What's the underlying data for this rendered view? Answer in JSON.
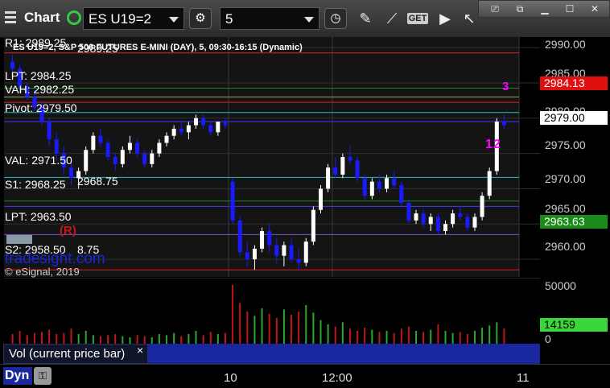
{
  "toolbar": {
    "title": "Chart",
    "symbol": "ES U19=2",
    "interval": "5",
    "get_label": "GET"
  },
  "chart_header": {
    "title": "ES U19=2, S&P 500 FUTURES E-MINI (DAY), 5, 09:30-16:15 (Dynamic)",
    "copyright": "© eSignal, 2019",
    "watermark": "tradesight.com"
  },
  "price_axis": {
    "ticks": [
      "2990.00",
      "2985.00",
      "2980.00",
      "2975.00",
      "2970.00",
      "2965.00",
      "2960.00"
    ],
    "tag_high": "2984.13",
    "tag_last": "2979.00",
    "tag_low": "2963.63"
  },
  "volume_axis": {
    "ticks": [
      "50000",
      "0"
    ],
    "tag_volume": "14159"
  },
  "levels": {
    "r1": "R1: 2989.25",
    "r1_extra": "2989.25",
    "lpt_upper": "LPT: 2984.25",
    "vah": "VAH: 2982.25",
    "pivot": "Pivot: 2979.50",
    "val": "VAL: 2971.50",
    "s1": "S1: 2968.25",
    "s1_extra": "2968.75",
    "lpt_lower": "LPT: 2963.50",
    "s2": "S2: 2958.50",
    "s2_extra": "8.75",
    "reversal": "(R)"
  },
  "markers": [
    "1",
    "2",
    "3"
  ],
  "legend": {
    "label": "Vol (current price bar)",
    "close": "×"
  },
  "x_axis": {
    "labels": [
      "10",
      "12:00",
      "11"
    ],
    "dyn_label": "Dyn"
  },
  "colors": {
    "up_candle": "#ffffff",
    "down_candle": "#1a1aff",
    "pivot_line": "#3a3aff",
    "r1_line": "#e02020",
    "val_line": "#20c0c0",
    "low_tag": "#1a8a1a",
    "high_tag": "#e01010",
    "volume_up": "#2aa82a",
    "volume_down": "#c01818"
  },
  "chart_data": {
    "type": "candlestick",
    "ylim": [
      2957.5,
      2991.5
    ],
    "ohlc": [
      [
        2988.0,
        2989.0,
        2986.5,
        2987.0
      ],
      [
        2987.0,
        2987.5,
        2984.0,
        2984.5
      ],
      [
        2984.5,
        2985.0,
        2982.5,
        2983.0
      ],
      [
        2983.0,
        2984.0,
        2981.0,
        2981.5
      ],
      [
        2981.5,
        2982.5,
        2979.0,
        2979.5
      ],
      [
        2979.5,
        2980.0,
        2976.0,
        2977.0
      ],
      [
        2977.0,
        2978.0,
        2974.0,
        2975.0
      ],
      [
        2975.0,
        2976.0,
        2972.0,
        2973.0
      ],
      [
        2973.0,
        2974.5,
        2970.5,
        2971.5
      ],
      [
        2971.5,
        2973.0,
        2970.0,
        2972.5
      ],
      [
        2972.5,
        2976.0,
        2972.0,
        2975.5
      ],
      [
        2975.5,
        2978.0,
        2975.0,
        2977.5
      ],
      [
        2977.5,
        2978.5,
        2976.0,
        2976.5
      ],
      [
        2976.5,
        2977.0,
        2974.0,
        2974.5
      ],
      [
        2974.5,
        2975.0,
        2972.5,
        2973.5
      ],
      [
        2973.5,
        2976.0,
        2973.0,
        2975.5
      ],
      [
        2975.5,
        2977.5,
        2975.0,
        2976.5
      ],
      [
        2976.5,
        2977.0,
        2974.5,
        2975.0
      ],
      [
        2975.0,
        2975.5,
        2973.0,
        2973.5
      ],
      [
        2973.5,
        2975.5,
        2973.0,
        2975.0
      ],
      [
        2975.0,
        2977.0,
        2974.5,
        2976.5
      ],
      [
        2976.5,
        2978.0,
        2976.0,
        2977.5
      ],
      [
        2977.5,
        2979.0,
        2977.0,
        2978.5
      ],
      [
        2978.5,
        2979.5,
        2977.5,
        2978.0
      ],
      [
        2978.0,
        2979.5,
        2977.0,
        2979.0
      ],
      [
        2979.0,
        2980.5,
        2978.5,
        2980.0
      ],
      [
        2980.0,
        2980.5,
        2978.5,
        2979.0
      ],
      [
        2979.0,
        2979.5,
        2977.5,
        2978.0
      ],
      [
        2978.0,
        2979.5,
        2977.5,
        2979.5
      ],
      [
        2979.5,
        2980.0,
        2978.5,
        2979.0
      ],
      [
        2971.0,
        2971.5,
        2965.0,
        2965.5
      ],
      [
        2965.5,
        2966.0,
        2960.5,
        2961.0
      ],
      [
        2961.0,
        2962.5,
        2959.0,
        2960.0
      ],
      [
        2960.0,
        2962.0,
        2958.5,
        2961.5
      ],
      [
        2961.5,
        2964.5,
        2961.0,
        2964.0
      ],
      [
        2964.0,
        2965.0,
        2961.0,
        2962.0
      ],
      [
        2962.0,
        2963.0,
        2959.5,
        2960.5
      ],
      [
        2960.5,
        2962.5,
        2959.0,
        2962.0
      ],
      [
        2962.0,
        2963.0,
        2959.5,
        2960.0
      ],
      [
        2960.0,
        2961.5,
        2958.5,
        2959.5
      ],
      [
        2959.5,
        2963.0,
        2959.0,
        2962.5
      ],
      [
        2962.5,
        2967.5,
        2962.0,
        2967.0
      ],
      [
        2967.0,
        2970.5,
        2966.5,
        2970.0
      ],
      [
        2970.0,
        2973.5,
        2969.5,
        2973.0
      ],
      [
        2973.0,
        2974.5,
        2971.5,
        2972.0
      ],
      [
        2972.0,
        2975.0,
        2971.5,
        2974.5
      ],
      [
        2974.5,
        2976.0,
        2973.5,
        2974.0
      ],
      [
        2974.0,
        2974.5,
        2971.0,
        2971.5
      ],
      [
        2971.5,
        2972.0,
        2968.5,
        2969.0
      ],
      [
        2969.0,
        2971.5,
        2968.5,
        2971.0
      ],
      [
        2971.0,
        2972.0,
        2969.5,
        2970.0
      ],
      [
        2970.0,
        2972.0,
        2969.5,
        2971.5
      ],
      [
        2971.5,
        2972.5,
        2970.0,
        2970.5
      ],
      [
        2970.5,
        2971.0,
        2967.5,
        2968.0
      ],
      [
        2968.0,
        2968.5,
        2965.0,
        2965.5
      ],
      [
        2965.5,
        2967.0,
        2965.0,
        2966.5
      ],
      [
        2966.5,
        2967.0,
        2964.5,
        2965.0
      ],
      [
        2965.0,
        2966.5,
        2964.0,
        2966.0
      ],
      [
        2966.0,
        2966.5,
        2963.5,
        2964.0
      ],
      [
        2964.0,
        2965.5,
        2963.5,
        2965.0
      ],
      [
        2965.0,
        2967.0,
        2964.5,
        2966.5
      ],
      [
        2966.5,
        2967.5,
        2965.5,
        2966.0
      ],
      [
        2966.0,
        2966.5,
        2964.0,
        2964.5
      ],
      [
        2964.5,
        2966.5,
        2964.0,
        2966.0
      ],
      [
        2966.0,
        2969.5,
        2965.5,
        2969.0
      ],
      [
        2969.0,
        2973.0,
        2968.5,
        2972.5
      ],
      [
        2972.5,
        2980.0,
        2972.0,
        2979.5
      ],
      [
        2979.5,
        2980.5,
        2978.5,
        2979.0
      ]
    ],
    "volume": [
      9000,
      12000,
      8000,
      10000,
      11000,
      13000,
      9000,
      10000,
      14000,
      9000,
      12000,
      8000,
      7000,
      8000,
      9000,
      7000,
      6000,
      8000,
      7000,
      6000,
      9000,
      8000,
      10000,
      7000,
      9000,
      12000,
      8000,
      11000,
      9000,
      10000,
      55000,
      38000,
      30000,
      26000,
      33000,
      28000,
      24000,
      32000,
      27000,
      30000,
      36000,
      29000,
      22000,
      18000,
      16000,
      20000,
      14000,
      12000,
      15000,
      13000,
      11000,
      12000,
      10000,
      14000,
      16000,
      12000,
      11000,
      13000,
      18000,
      12000,
      10000,
      11000,
      9000,
      12000,
      15000,
      17000,
      20000,
      14159
    ]
  }
}
